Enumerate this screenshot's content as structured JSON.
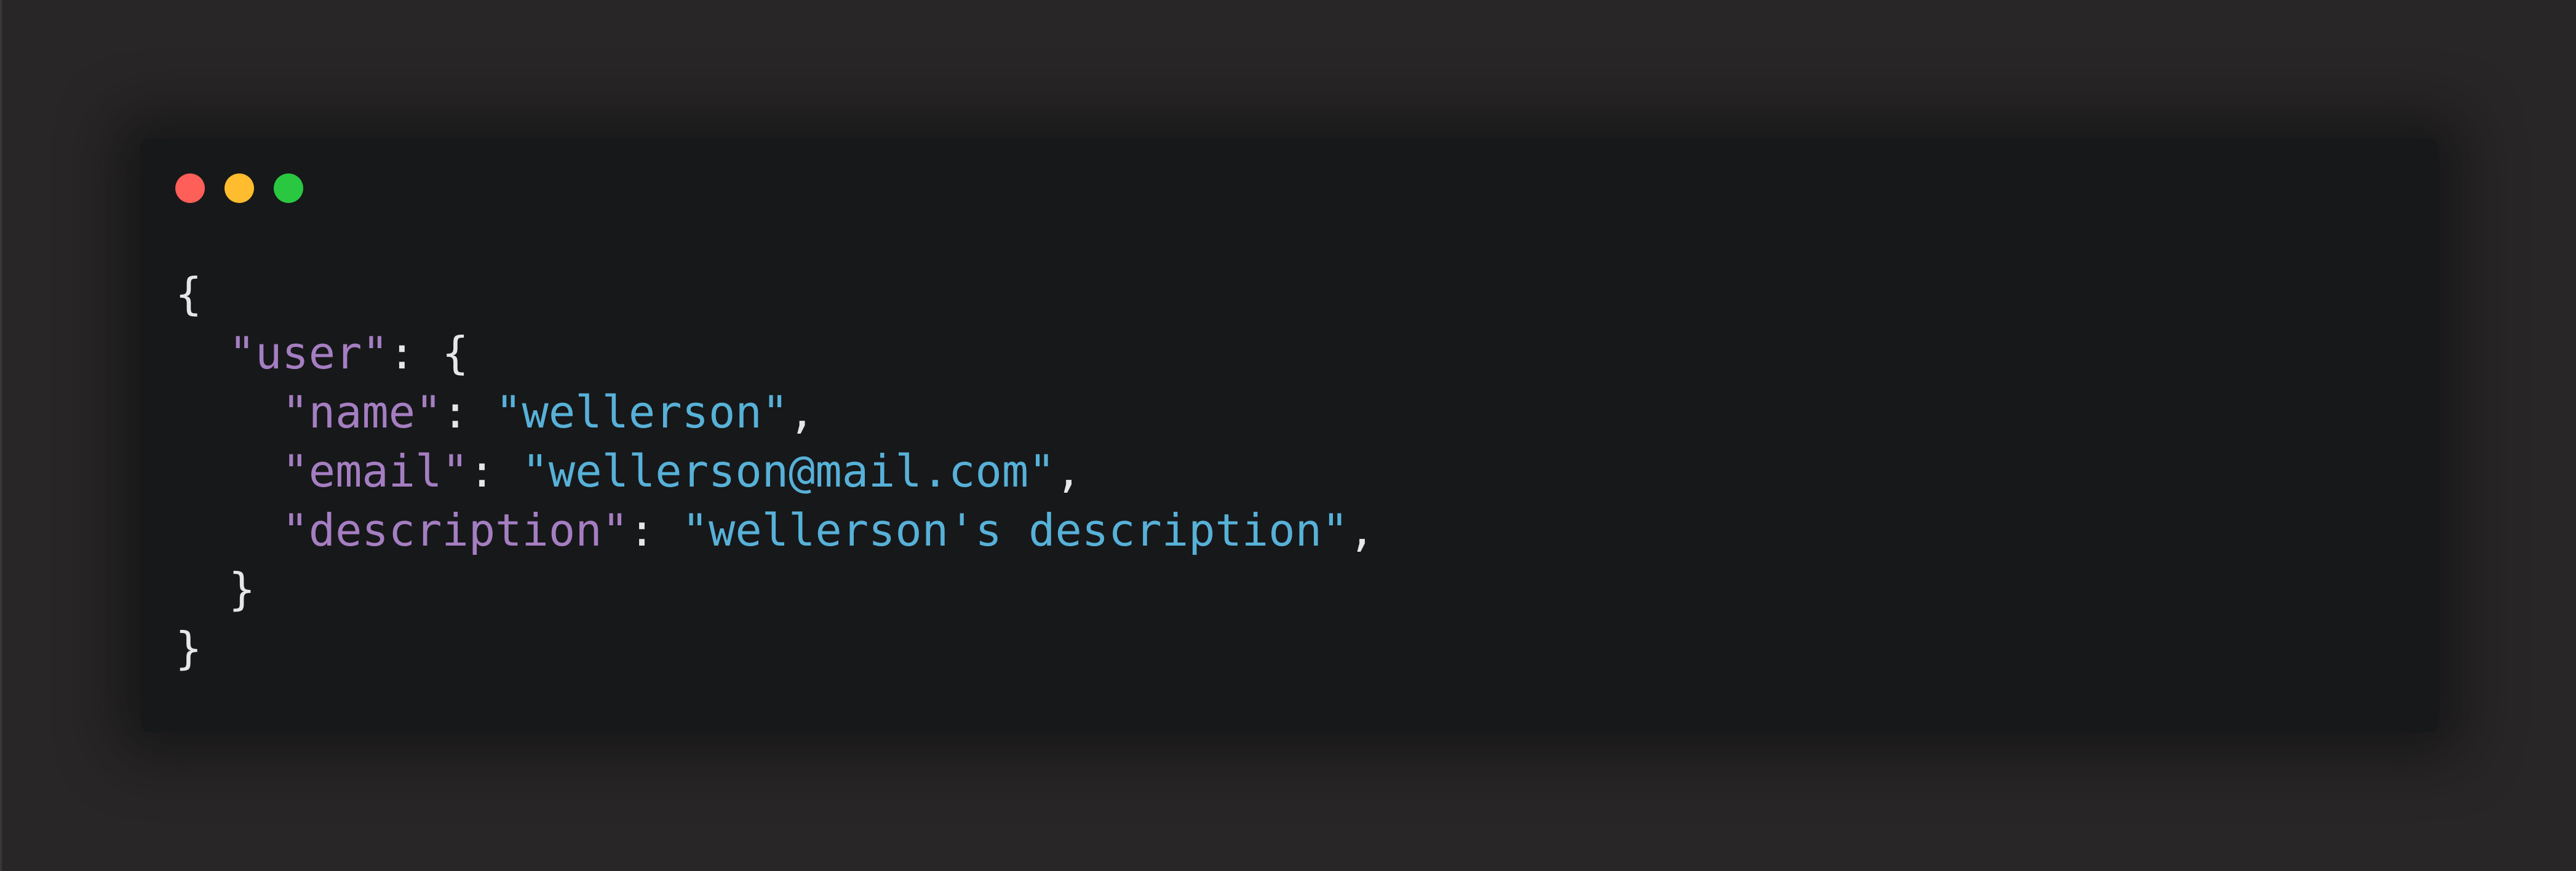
{
  "colors": {
    "background": "#282627",
    "window_bg": "#17181a",
    "close": "#fe5f58",
    "minimize": "#febc2e",
    "maximize": "#29c840",
    "key": "#a57ec2",
    "string": "#57b1d8",
    "punctuation": "#e6e6e6"
  },
  "window": {
    "controls": [
      "close",
      "minimize",
      "maximize"
    ]
  },
  "code": {
    "open_brace": "{",
    "user_key": "\"user\"",
    "user_colon": ": {",
    "name_key": "\"name\"",
    "name_colon": ": ",
    "name_value": "\"wellerson\"",
    "name_comma": ",",
    "email_key": "\"email\"",
    "email_colon": ": ",
    "email_value": "\"wellerson@mail.com\"",
    "email_comma": ",",
    "description_key": "\"description\"",
    "description_colon": ": ",
    "description_value": "\"wellerson's description\"",
    "description_comma": ",",
    "inner_close": "}",
    "outer_close": "}"
  }
}
